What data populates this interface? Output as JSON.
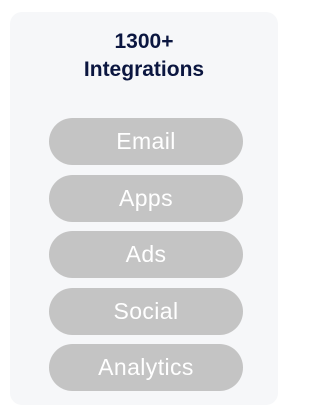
{
  "card": {
    "title_line1": "1300+",
    "title_line2": "Integrations"
  },
  "categories": [
    {
      "label": "Email"
    },
    {
      "label": "Apps"
    },
    {
      "label": "Ads"
    },
    {
      "label": "Social"
    },
    {
      "label": "Analytics"
    }
  ],
  "colors": {
    "card_background": "#f6f7f9",
    "title_text": "#0b1640",
    "pill_background": "#c4c4c4",
    "pill_text": "#ffffff"
  }
}
